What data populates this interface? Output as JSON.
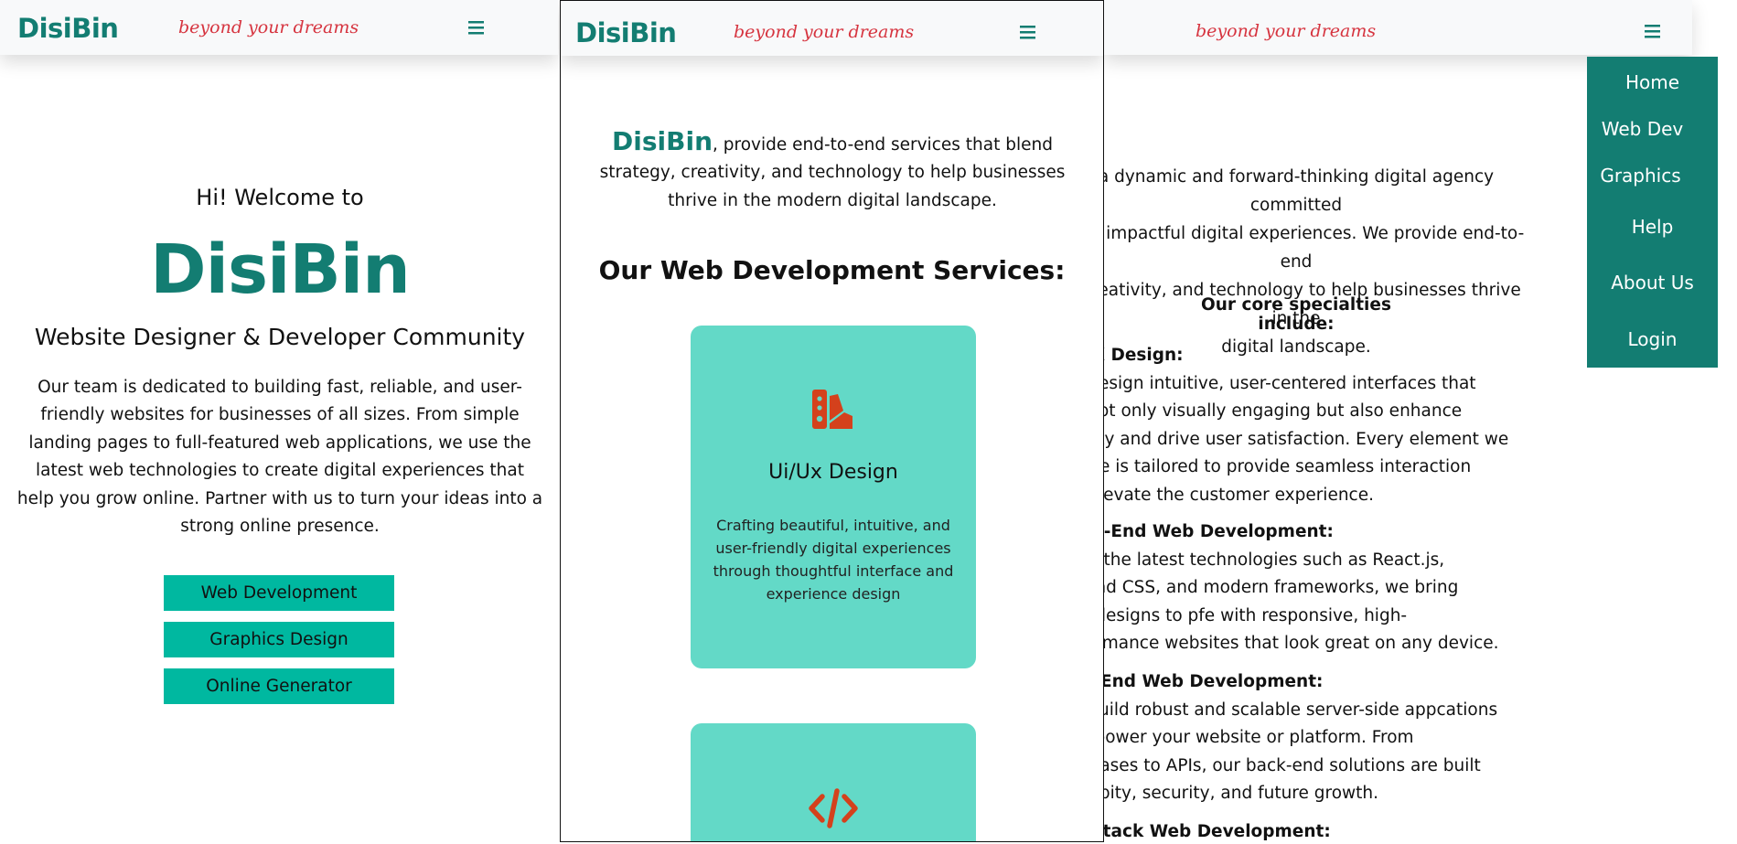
{
  "brand": "DisiBin",
  "tagline": "beyond your dreams",
  "left_view": {
    "greeting": "Hi! Welcome to",
    "hero_title": "DisiBin",
    "subtitle": "Website Designer & Developer Community",
    "intro": "Our team is dedicated to building fast, reliable, and user-friendly websites for businesses of all sizes. From simple landing pages to full-featured web applications, we use the latest web technologies to create digital experiences that help you grow online. Partner with us to turn your ideas into a strong online presence.",
    "buttons": [
      "Web Development",
      "Graphics Design",
      "Online Generator"
    ]
  },
  "middle_view": {
    "lead_brand": "DisiBin",
    "lead_text": ", provide end-to-end services that blend strategy, creativity, and technology to help businesses thrive in the modern digital landscape.",
    "heading": "Our Web Development Services:",
    "cards": [
      {
        "icon": "palette-swatch-icon",
        "title": "Ui/Ux Design",
        "desc": "Crafting beautiful, intuitive, and user-friendly digital experiences through thoughtful interface and experience design"
      },
      {
        "icon": "code-icon",
        "title": "",
        "desc": ""
      }
    ]
  },
  "right_view": {
    "about_lines": [
      "a dynamic and forward-thinking digital agency committed",
      "into impactful digital experiences. We provide end-to-end",
      ", creativity, and technology to help businesses thrive in the",
      "digital landscape."
    ],
    "specialties_title": "Our core specialties include:",
    "specialties": [
      {
        "heading": "/UX Design:",
        "lines": [
          "e design intuitive, user-centered interfaces that",
          "e not only visually engaging but also enhance",
          "abity and drive user satisfaction. Every element we",
          "eate is tailored to provide seamless interaction",
          "d elevate the customer experience."
        ]
      },
      {
        "heading": "ont-End Web Development:",
        "lines": [
          "ing the latest technologies such as React.js,",
          "lwind CSS, and modern frameworks, we bring",
          "ur designs to pfe with responsive, high-",
          "rformance websites that look great on any device."
        ]
      },
      {
        "heading": "ck-End Web Development:",
        "lines": [
          "e build robust and scalable server-side appcations",
          "at power your website or platform. From",
          "tabases to APIs, our back-end solutions are built",
          " reabity, security, and future growth."
        ]
      },
      {
        "heading": "ll-Stack Web Development:",
        "lines": []
      }
    ],
    "menu": [
      "Home",
      "Web Dev",
      "Graphics",
      "Help",
      "About Us",
      "Login"
    ]
  },
  "colors": {
    "brand": "#137d72",
    "tagline": "#d6343f",
    "button": "#00b8a0",
    "card": "#63d9c7",
    "icon": "#d4411c",
    "menu": "#137d72"
  }
}
